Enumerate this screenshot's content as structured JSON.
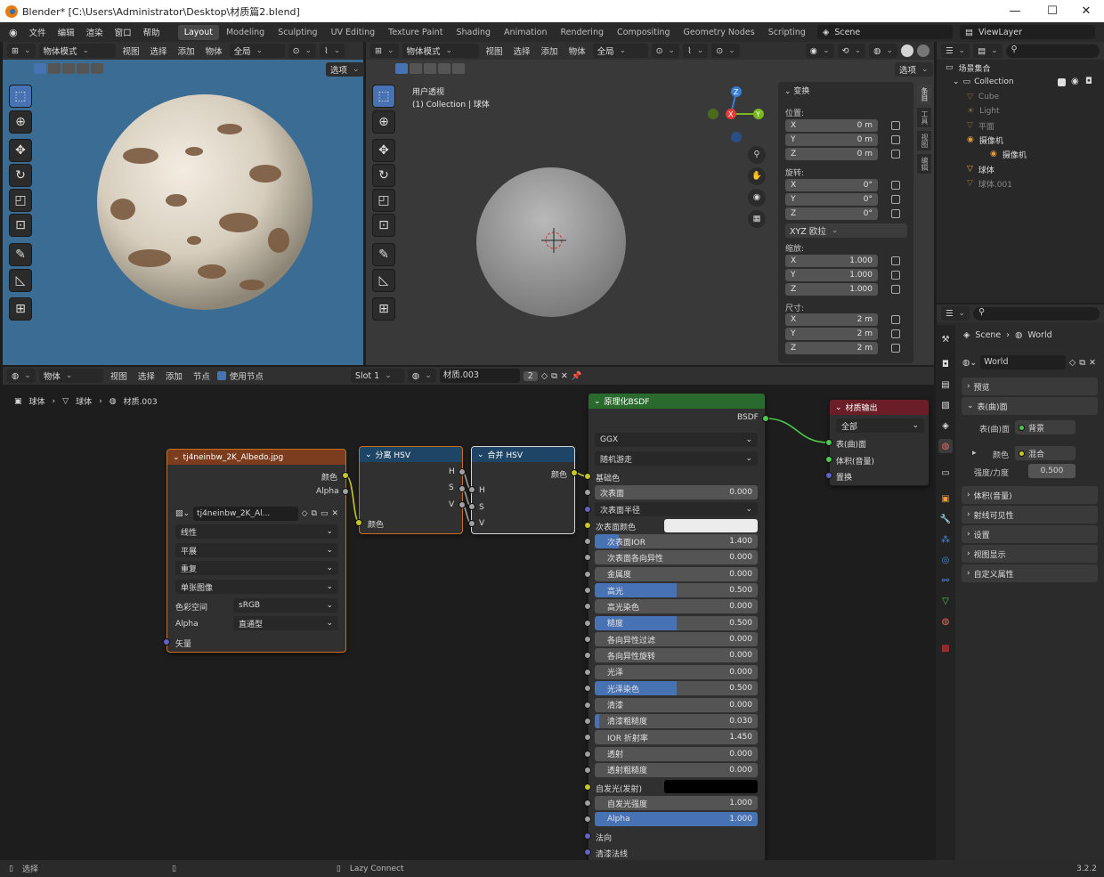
{
  "window": {
    "title": "Blender* [C:\\Users\\Administrator\\Desktop\\材质篇2.blend]"
  },
  "menu": [
    "文件",
    "编辑",
    "渲染",
    "窗口",
    "帮助"
  ],
  "workspaces": [
    "Layout",
    "Modeling",
    "Sculpting",
    "UV Editing",
    "Texture Paint",
    "Shading",
    "Animation",
    "Rendering",
    "Compositing",
    "Geometry Nodes",
    "Scripting"
  ],
  "scene": "Scene",
  "view_layer": "ViewLayer",
  "viewport_left": {
    "mode": "物体模式",
    "menus": [
      "视图",
      "选择",
      "添加",
      "物体"
    ],
    "transform": "全局",
    "options": "选项"
  },
  "viewport_right": {
    "mode": "物体模式",
    "menus": [
      "视图",
      "选择",
      "添加",
      "物体"
    ],
    "transform": "全局",
    "options": "选项",
    "view_name": "用户透视",
    "context": "(1) Collection | 球体"
  },
  "n_panel": {
    "header": "变换",
    "location_label": "位置:",
    "location": [
      {
        "axis": "X",
        "value": "0 m"
      },
      {
        "axis": "Y",
        "value": "0 m"
      },
      {
        "axis": "Z",
        "value": "0 m"
      }
    ],
    "rotation_label": "旋转:",
    "rotation": [
      {
        "axis": "X",
        "value": "0°"
      },
      {
        "axis": "Y",
        "value": "0°"
      },
      {
        "axis": "Z",
        "value": "0°"
      }
    ],
    "rotation_mode": "XYZ 欧拉",
    "scale_label": "缩放:",
    "scale": [
      {
        "axis": "X",
        "value": "1.000"
      },
      {
        "axis": "Y",
        "value": "1.000"
      },
      {
        "axis": "Z",
        "value": "1.000"
      }
    ],
    "dimensions_label": "尺寸:",
    "dimensions": [
      {
        "axis": "X",
        "value": "2 m"
      },
      {
        "axis": "Y",
        "value": "2 m"
      },
      {
        "axis": "Z",
        "value": "2 m"
      }
    ],
    "tabs": [
      "条目",
      "工具",
      "视图",
      "编辑"
    ]
  },
  "outliner": {
    "root": "场景集合",
    "collection": "Collection",
    "items": [
      {
        "name": "Cube",
        "dim": true
      },
      {
        "name": "Light",
        "dim": true
      },
      {
        "name": "平面",
        "dim": true
      },
      {
        "name": "摄像机",
        "dim": false
      },
      {
        "name": "摄像机",
        "dim": false,
        "child": true
      },
      {
        "name": "球体",
        "dim": false
      },
      {
        "name": "球体.001",
        "dim": true
      }
    ]
  },
  "properties": {
    "breadcrumb": [
      "Scene",
      "World"
    ],
    "world_name": "World",
    "panels": [
      "预览",
      "表(曲)面",
      "体积(音量)",
      "射线可见性",
      "设置",
      "视图显示",
      "自定义属性"
    ],
    "surface_label": "表(曲)面",
    "surface_value": "背景",
    "color_label": "颜色",
    "color_value": "混合",
    "strength_label": "强度/力度",
    "strength_value": "0.500"
  },
  "node_editor": {
    "type": "物体",
    "menus": [
      "视图",
      "选择",
      "添加",
      "节点"
    ],
    "use_nodes": "使用节点",
    "slot": "Slot 1",
    "material": "材质.003",
    "users": "2",
    "breadcrumb": [
      "球体",
      "球体",
      "材质.003"
    ]
  },
  "nodes": {
    "image": {
      "title": "tj4neinbw_2K_Albedo.jpg",
      "out_color": "颜色",
      "out_alpha": "Alpha",
      "image_name": "tj4neinbw_2K_Al...",
      "interp": "线性",
      "proj": "平展",
      "ext": "重复",
      "source": "单张图像",
      "colorspace_label": "色彩空间",
      "colorspace": "sRGB",
      "alpha_label": "Alpha",
      "alpha": "直通型",
      "in_vector": "矢量"
    },
    "sep": {
      "title": "分离 HSV",
      "outs": [
        "H",
        "S",
        "V"
      ],
      "in": "颜色"
    },
    "comb": {
      "title": "合并 HSV",
      "out": "颜色",
      "ins": [
        "H",
        "S",
        "V"
      ]
    },
    "bsdf": {
      "title": "原理化BSDF",
      "out": "BSDF",
      "dist": "GGX",
      "sss_method": "随机游走",
      "base_color": "基础色",
      "subsurface": {
        "label": "次表面",
        "value": "0.000"
      },
      "subsurface_radius": "次表面半径",
      "subsurface_color": "次表面颜色",
      "fields": [
        {
          "label": "次表面IOR",
          "value": "1.400",
          "fill": 0.15
        },
        {
          "label": "次表面各向异性",
          "value": "0.000",
          "fill": 0
        },
        {
          "label": "金属度",
          "value": "0.000",
          "fill": 0
        },
        {
          "label": "高光",
          "value": "0.500",
          "fill": 0.5
        },
        {
          "label": "高光染色",
          "value": "0.000",
          "fill": 0
        },
        {
          "label": "糙度",
          "value": "0.500",
          "fill": 0.5
        },
        {
          "label": "各向异性过滤",
          "value": "0.000",
          "fill": 0
        },
        {
          "label": "各向异性旋转",
          "value": "0.000",
          "fill": 0
        },
        {
          "label": "光泽",
          "value": "0.000",
          "fill": 0
        },
        {
          "label": "光泽染色",
          "value": "0.500",
          "fill": 0.5
        },
        {
          "label": "清漆",
          "value": "0.000",
          "fill": 0
        },
        {
          "label": "清漆粗糙度",
          "value": "0.030",
          "fill": 0.03
        },
        {
          "label": "IOR 折射率",
          "value": "1.450",
          "fill": 0
        },
        {
          "label": "透射",
          "value": "0.000",
          "fill": 0
        },
        {
          "label": "透射粗糙度",
          "value": "0.000",
          "fill": 0
        }
      ],
      "emission": "自发光(发射)",
      "emission_strength": {
        "label": "自发光强度",
        "value": "1.000"
      },
      "alpha": {
        "label": "Alpha",
        "value": "1.000"
      },
      "normal": "法向",
      "clearcoat_normal": "清漆法线"
    },
    "output": {
      "title": "材质输出",
      "target": "全部",
      "ins": [
        "表(曲)面",
        "体积(音量)",
        "置换"
      ]
    }
  },
  "statusbar": {
    "select": "选择",
    "lazy": "Lazy Connect",
    "version": "3.2.2"
  }
}
